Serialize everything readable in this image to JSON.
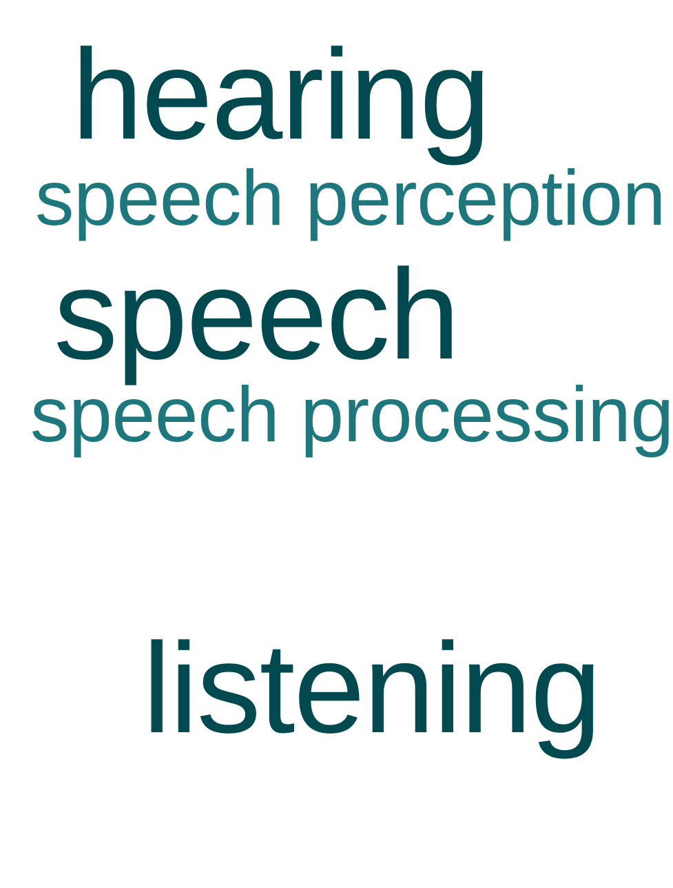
{
  "word_cloud": {
    "words": [
      {
        "text": "hearing",
        "color": "#024a4f"
      },
      {
        "text": "speech perception",
        "color": "#1e777c"
      },
      {
        "text": "speech",
        "color": "#024a4f"
      },
      {
        "text": "speech processing",
        "color": "#1e777c"
      },
      {
        "text": "listening",
        "color": "#024a4f"
      }
    ]
  }
}
